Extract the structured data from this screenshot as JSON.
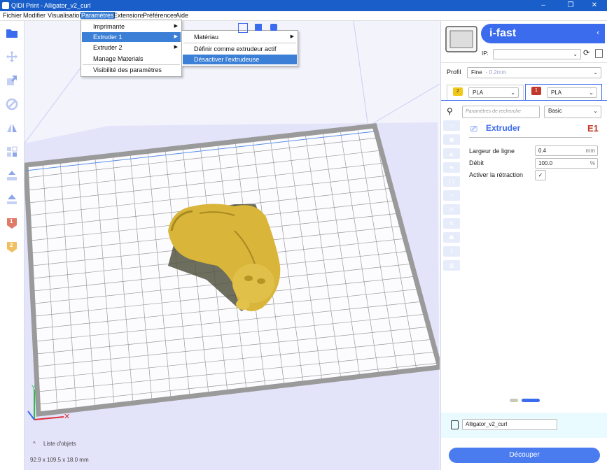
{
  "window": {
    "title": "QIDI Print - Alligator_v2_curl",
    "minimize": "–",
    "maximize": "❐",
    "close": "✕"
  },
  "menubar": {
    "items": [
      "Fichier",
      "Modifier",
      "Visualisation",
      "Paramètres",
      "Extensions",
      "Préférences",
      "Aide"
    ]
  },
  "menu_parametres": {
    "items": [
      "Imprimante",
      "Extruder 1",
      "Extruder 2",
      "Manage Materials",
      "Visibilité des paramètres"
    ]
  },
  "menu_extruder1": {
    "items": [
      "Matériau",
      "Définir comme extrudeur actif",
      "Désactiver l'extrudeuse"
    ]
  },
  "left_toolbar": {
    "icons": [
      "folder-icon",
      "move-icon",
      "scale-icon",
      "rotate-icon",
      "mirror-icon",
      "per-model-settings-icon",
      "support-blocker-icon",
      "lay-flat-icon",
      "extruder-1-icon",
      "extruder-2-icon"
    ],
    "extruder_1_badge": "1",
    "extruder_2_badge": "2"
  },
  "viewport": {
    "object_list_label": "Liste d'objets",
    "dimensions": "92.9 x 109.5 x 18.0 mm",
    "model_color": "#d9b53a"
  },
  "printer": {
    "name": "i-fast",
    "ip_label": "IP:",
    "ip_value": "",
    "back_chevron": "‹"
  },
  "profile": {
    "label": "Profil",
    "value": "Fine",
    "value_suffix": "- 0.2mm"
  },
  "extruder_tabs": [
    {
      "badge": "2",
      "material": "PLA",
      "badge_color": "#f2c818"
    },
    {
      "badge": "1",
      "material": "PLA",
      "badge_color": "#c0392b"
    }
  ],
  "settings": {
    "search_placeholder": "Paramètres de recherche",
    "mode": "Basic",
    "section_title": "Extruder",
    "section_tag": "E1",
    "rows": [
      {
        "label": "Largeur de ligne",
        "value": "0.4",
        "unit": "mm"
      },
      {
        "label": "Débit",
        "value": "100.0",
        "unit": "%"
      },
      {
        "label": "Activer la rétraction",
        "value": "✓",
        "unit": ""
      }
    ]
  },
  "pager": {
    "active_index": 1,
    "count": 2
  },
  "job": {
    "name": "Alligator_v2_curl"
  },
  "slice_button": "Découper",
  "colors": {
    "accent": "#3c6cee",
    "titlebar": "#1a5fc9",
    "menu_highlight": "#3b7fd6",
    "build_plate_border": "#a9a9a9",
    "error_red": "#c0392b"
  }
}
